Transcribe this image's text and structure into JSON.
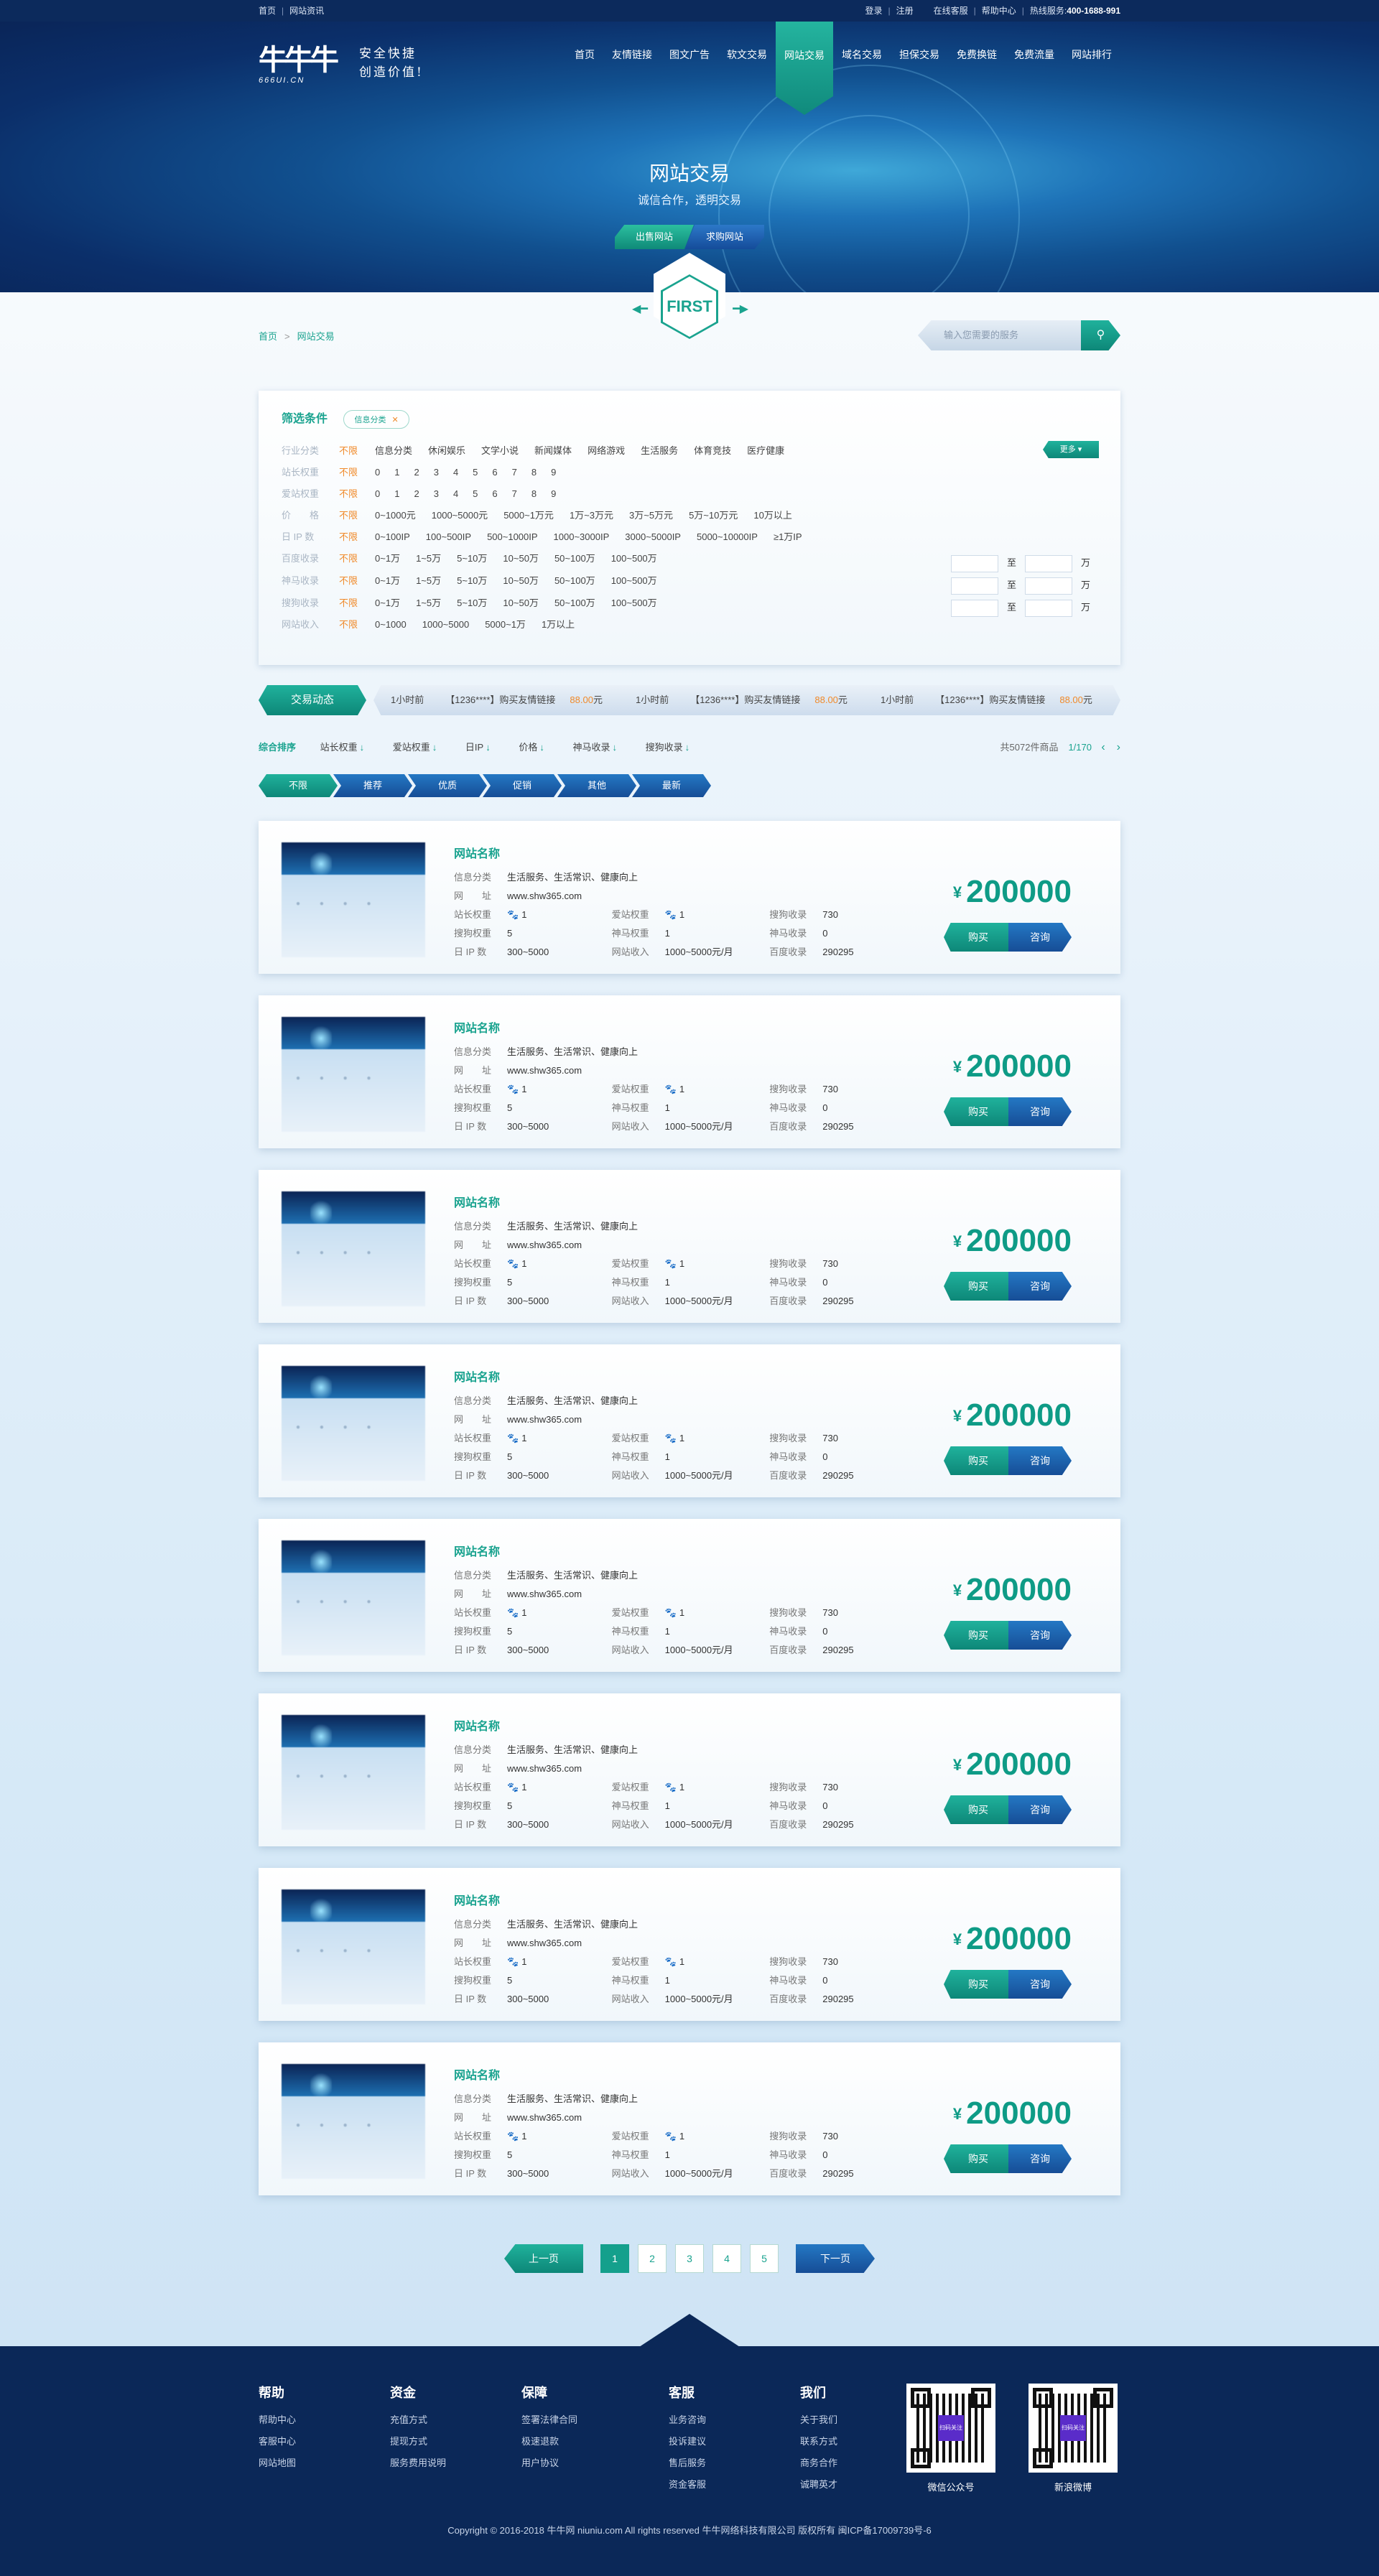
{
  "topbar": {
    "left": [
      "首页",
      "网站资讯"
    ],
    "right": [
      "登录",
      "注册",
      "在线客服",
      "帮助中心"
    ],
    "hotline_label": "热线服务:",
    "hotline": "400-1688-991"
  },
  "brand": {
    "mark": "牛牛牛",
    "url": "666UI.CN",
    "slogan_1": "安全快捷",
    "slogan_2": "创造价值!"
  },
  "nav": [
    "首页",
    "友情链接",
    "图文广告",
    "软文交易",
    "网站交易",
    "域名交易",
    "担保交易",
    "免费换链",
    "免费流量",
    "网站排行"
  ],
  "nav_active": 4,
  "hero": {
    "title": "网站交易",
    "subtitle": "诚信合作，透明交易",
    "btn_sell": "出售网站",
    "btn_buy": "求购网站"
  },
  "badge": "FIRST",
  "breadcrumb": [
    "首页",
    "网站交易"
  ],
  "search": {
    "placeholder": "输入您需要的服务"
  },
  "filter": {
    "title": "筛选条件",
    "tag": "信息分类",
    "more": "更多",
    "all": "不限",
    "rows": [
      {
        "label": "行业分类",
        "options": [
          "信息分类",
          "休闲娱乐",
          "文学小说",
          "新闻媒体",
          "网络游戏",
          "生活服务",
          "体育竞技",
          "医疗健康"
        ]
      },
      {
        "label": "站长权重",
        "options": [
          "0",
          "1",
          "2",
          "3",
          "4",
          "5",
          "6",
          "7",
          "8",
          "9"
        ]
      },
      {
        "label": "爱站权重",
        "options": [
          "0",
          "1",
          "2",
          "3",
          "4",
          "5",
          "6",
          "7",
          "8",
          "9"
        ]
      },
      {
        "label": "价　　格",
        "options": [
          "0~1000元",
          "1000~5000元",
          "5000~1万元",
          "1万~3万元",
          "3万~5万元",
          "5万~10万元",
          "10万以上"
        ]
      },
      {
        "label": "日 IP 数",
        "options": [
          "0~100IP",
          "100~500IP",
          "500~1000IP",
          "1000~3000IP",
          "3000~5000IP",
          "5000~10000IP",
          "≥1万IP"
        ]
      },
      {
        "label": "百度收录",
        "options": [
          "0~1万",
          "1~5万",
          "5~10万",
          "10~50万",
          "50~100万",
          "100~500万"
        ]
      },
      {
        "label": "神马收录",
        "options": [
          "0~1万",
          "1~5万",
          "5~10万",
          "10~50万",
          "50~100万",
          "100~500万"
        ]
      },
      {
        "label": "搜狗收录",
        "options": [
          "0~1万",
          "1~5万",
          "5~10万",
          "10~50万",
          "50~100万",
          "100~500万"
        ]
      },
      {
        "label": "网站收入",
        "options": [
          "0~1000",
          "1000~5000",
          "5000~1万",
          "1万以上"
        ]
      }
    ],
    "range_to": "至",
    "range_unit": "万"
  },
  "ticker": {
    "label": "交易动态",
    "items": [
      {
        "time": "1小时前",
        "text": "【1236****】购买友情链接",
        "price": "88.00",
        "unit": "元"
      },
      {
        "time": "1小时前",
        "text": "【1236****】购买友情链接",
        "price": "88.00",
        "unit": "元"
      },
      {
        "time": "1小时前",
        "text": "【1236****】购买友情链接",
        "price": "88.00",
        "unit": "元"
      }
    ]
  },
  "sort": {
    "items": [
      "综合排序",
      "站长权重",
      "爱站权重",
      "日IP",
      "价格",
      "神马收录",
      "搜狗收录"
    ],
    "total": "共5072件商品",
    "page": "1/170"
  },
  "tabs": [
    "不限",
    "推荐",
    "优质",
    "促销",
    "其他",
    "最新"
  ],
  "listing": {
    "name": "网站名称",
    "labels": {
      "category": "信息分类",
      "url": "网　　址",
      "zz": "站长权重",
      "az": "爱站权重",
      "sg": "搜狗收录",
      "sgw": "搜狗权重",
      "sm": "神马权重",
      "smsl": "神马收录",
      "ip": "日 IP 数",
      "income": "网站收入",
      "bd": "百度收录"
    },
    "items": [
      {
        "category": "生活服务、生活常识、健康向上",
        "url": "www.shw365.com",
        "zz": "1",
        "az": "1",
        "sg": "730",
        "sgw": "5",
        "sm": "1",
        "smsl": "0",
        "ip": "300~5000",
        "income": "1000~5000元/月",
        "bd": "290295",
        "currency": "¥",
        "price": "200000"
      },
      {
        "category": "生活服务、生活常识、健康向上",
        "url": "www.shw365.com",
        "zz": "1",
        "az": "1",
        "sg": "730",
        "sgw": "5",
        "sm": "1",
        "smsl": "0",
        "ip": "300~5000",
        "income": "1000~5000元/月",
        "bd": "290295",
        "currency": "¥",
        "price": "200000"
      },
      {
        "category": "生活服务、生活常识、健康向上",
        "url": "www.shw365.com",
        "zz": "1",
        "az": "1",
        "sg": "730",
        "sgw": "5",
        "sm": "1",
        "smsl": "0",
        "ip": "300~5000",
        "income": "1000~5000元/月",
        "bd": "290295",
        "currency": "¥",
        "price": "200000"
      },
      {
        "category": "生活服务、生活常识、健康向上",
        "url": "www.shw365.com",
        "zz": "1",
        "az": "1",
        "sg": "730",
        "sgw": "5",
        "sm": "1",
        "smsl": "0",
        "ip": "300~5000",
        "income": "1000~5000元/月",
        "bd": "290295",
        "currency": "¥",
        "price": "200000"
      },
      {
        "category": "生活服务、生活常识、健康向上",
        "url": "www.shw365.com",
        "zz": "1",
        "az": "1",
        "sg": "730",
        "sgw": "5",
        "sm": "1",
        "smsl": "0",
        "ip": "300~5000",
        "income": "1000~5000元/月",
        "bd": "290295",
        "currency": "¥",
        "price": "200000"
      },
      {
        "category": "生活服务、生活常识、健康向上",
        "url": "www.shw365.com",
        "zz": "1",
        "az": "1",
        "sg": "730",
        "sgw": "5",
        "sm": "1",
        "smsl": "0",
        "ip": "300~5000",
        "income": "1000~5000元/月",
        "bd": "290295",
        "currency": "¥",
        "price": "200000"
      },
      {
        "category": "生活服务、生活常识、健康向上",
        "url": "www.shw365.com",
        "zz": "1",
        "az": "1",
        "sg": "730",
        "sgw": "5",
        "sm": "1",
        "smsl": "0",
        "ip": "300~5000",
        "income": "1000~5000元/月",
        "bd": "290295",
        "currency": "¥",
        "price": "200000"
      },
      {
        "category": "生活服务、生活常识、健康向上",
        "url": "www.shw365.com",
        "zz": "1",
        "az": "1",
        "sg": "730",
        "sgw": "5",
        "sm": "1",
        "smsl": "0",
        "ip": "300~5000",
        "income": "1000~5000元/月",
        "bd": "290295",
        "currency": "¥",
        "price": "200000"
      }
    ],
    "buy": "购买",
    "ask": "咨询"
  },
  "pager": {
    "prev": "上一页",
    "pages": [
      "1",
      "2",
      "3",
      "4",
      "5"
    ],
    "current": 0,
    "next": "下一页"
  },
  "footer": {
    "cols": [
      {
        "title": "帮助",
        "links": [
          "帮助中心",
          "客服中心",
          "网站地图"
        ]
      },
      {
        "title": "资金",
        "links": [
          "充值方式",
          "提现方式",
          "服务费用说明"
        ]
      },
      {
        "title": "保障",
        "links": [
          "签署法律合同",
          "极速退款",
          "用户协议"
        ]
      },
      {
        "title": "客服",
        "links": [
          "业务咨询",
          "投诉建议",
          "售后服务",
          "资金客服"
        ]
      },
      {
        "title": "我们",
        "links": [
          "关于我们",
          "联系方式",
          "商务合作",
          "诚聘英才"
        ]
      }
    ],
    "qr": [
      {
        "label": "微信公众号",
        "center": "扫码关注"
      },
      {
        "label": "新浪微博",
        "center": "扫码关注"
      }
    ],
    "copyright": "Copyright © 2016-2018 牛牛网 niuniu.com All rights reserved 牛牛网络科技有限公司 版权所有 闽ICP备17009739号-6"
  },
  "colors": {
    "primary": "#1aa38f",
    "blue": "#164d96",
    "orange": "#f08a2a",
    "dark": "#0b2858"
  }
}
